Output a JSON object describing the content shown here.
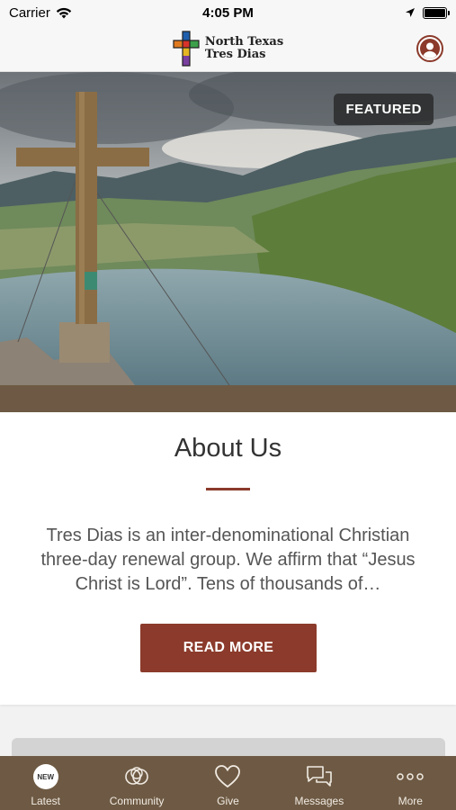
{
  "status_bar": {
    "carrier": "Carrier",
    "time": "4:05 PM"
  },
  "header": {
    "logo_line1": "North Texas",
    "logo_line2": "Tres Dias"
  },
  "hero": {
    "badge": "FEATURED"
  },
  "about": {
    "title": "About Us",
    "body": "Tres Dias is an inter-denominational Christian three-day renewal group. We affirm that “Jesus Christ is Lord”. Tens of thousands of…",
    "button": "READ MORE"
  },
  "tabs": [
    {
      "label": "Latest",
      "icon": "new-badge-icon",
      "badge": "NEW"
    },
    {
      "label": "Community",
      "icon": "community-icon"
    },
    {
      "label": "Give",
      "icon": "heart-icon"
    },
    {
      "label": "Messages",
      "icon": "messages-icon"
    },
    {
      "label": "More",
      "icon": "more-icon"
    }
  ],
  "colors": {
    "accent": "#8b3a2b",
    "tab_bar": "#6e5a44"
  }
}
